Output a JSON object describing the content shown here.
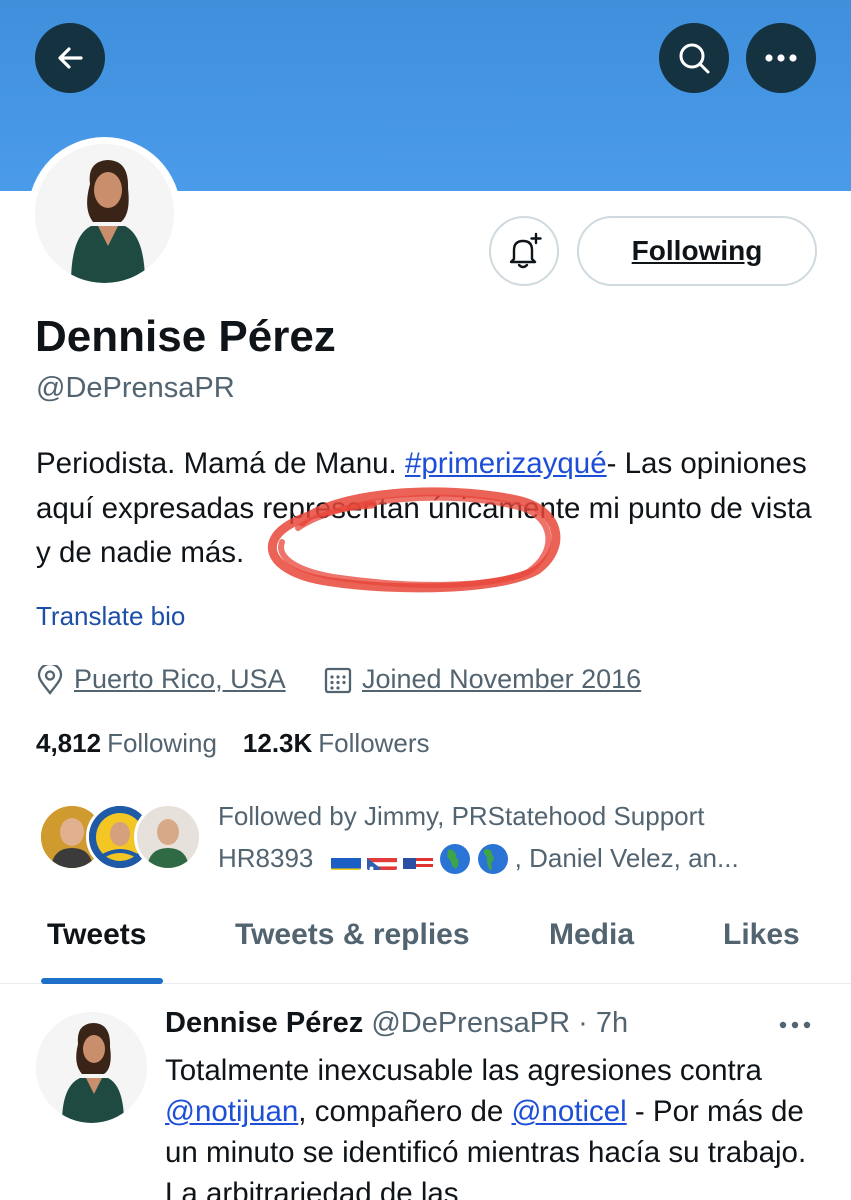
{
  "header": {
    "back_icon": "arrow-left-icon",
    "search_icon": "search-icon",
    "more_icon": "more-horizontal-icon",
    "banner_color": "#4a9bea"
  },
  "profile": {
    "name": "Dennise Pérez",
    "handle": "@DePrensaPR",
    "following_button": "Following",
    "notify_icon": "bell-plus-icon",
    "bio": {
      "part1": "Periodista. Mamá de Manu. ",
      "hashtag": "#primerizayqué",
      "part2": "- Las opiniones aquí expresadas representan únicamente mi punto de vista y de nadie más."
    },
    "translate": "Translate bio",
    "location": "Puerto Rico, USA",
    "joined": "Joined November 2016",
    "following_count": "4,812",
    "following_label": "Following",
    "followers_count": "12.3K",
    "followers_label": "Followers",
    "followed_by_line1": "Followed by Jimmy, PRStatehood Support",
    "followed_by_prefix": "HR8393",
    "followed_by_suffix": ", Daniel Velez, an..."
  },
  "tabs": {
    "items": [
      "Tweets",
      "Tweets & replies",
      "Media",
      "Likes"
    ],
    "active": "Tweets"
  },
  "tweet": {
    "author": "Dennise Pérez",
    "handle": "@DePrensaPR",
    "sep": "·",
    "time": "7h",
    "text1": "Totalmente inexcusable las agresiones contra ",
    "mention1": "@notijuan",
    "text2": ", compañero de ",
    "mention2": "@noticel",
    "text3": " - Por más de un minuto se identificó mientras hacía su trabajo. La arbitrariedad de las"
  }
}
